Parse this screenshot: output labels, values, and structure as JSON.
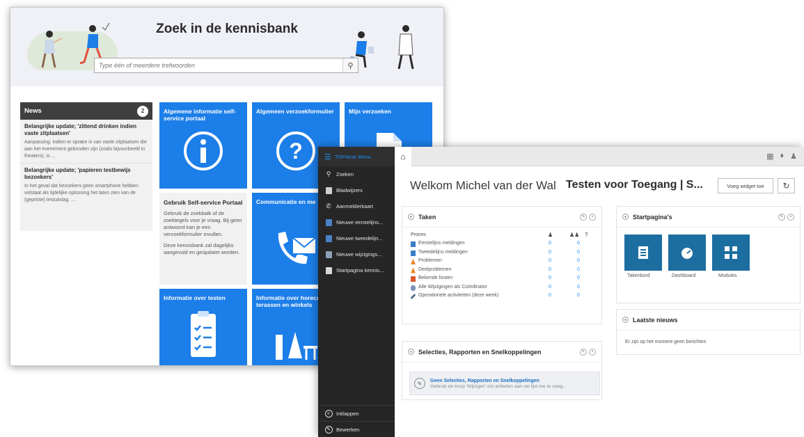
{
  "kb": {
    "title": "Zoek in de kennisbank",
    "search_placeholder": "Type één of meerdere trefwoorden",
    "news": {
      "header": "News",
      "count": "2",
      "items": [
        {
          "title": "Belangrijke update; 'zittend drinken indien vaste zitplaatsen'",
          "body": "Aanpassing: indien er sprake is van vaste zitplaatsen die aan het evenement gebonden zijn (zoals bijvoorbeeld in theaters), is ..."
        },
        {
          "title": "Belangrijke update; 'papieren testbewijs bezoekers'",
          "body": "In het geval dat bezoekers geen smartphone hebben volstaat als tijdelijke oplossing het laten zien van de (geprinte) testuitslag. ..."
        }
      ]
    },
    "tiles": {
      "info_portal": "Algemene informatie self-service portaal",
      "request_form": "Algemeen verzoekformulier",
      "my_requests": "Mijn verzoeken",
      "communication": "Communicatie en me",
      "testing_info": "Informatie over testen",
      "horeca_info": "Informatie over horeca, terassen en winkels"
    },
    "self_service": {
      "title": "Gebruik Self-service Portaal",
      "body1": "Gebruik de zoekbalk of de zoektegels voor je vraag. Bij geen antwoord kan je een verzoekformulier invullen.",
      "body2": "Deze kennisbank zal dagelijks aangevuld en geüpdatet worden."
    }
  },
  "td": {
    "menu_title": "TOPdesk Menu",
    "menu": [
      "Zoeken",
      "Bladwijzers",
      "Aanmelderkaart",
      "Nieuwe eerstelijns...",
      "Nieuwe tweedelijn...",
      "Nieuwe wijzigings...",
      "Startpagina kennis..."
    ],
    "bottom_menu": [
      "Inklappen",
      "Bewerken"
    ],
    "welcome": "Welkom Michel van der Wal",
    "page_title": "Testen voor Toegang | S...",
    "add_widget": "Voeg widget toe",
    "taken": {
      "title": "Taken",
      "col_proces": "Proces",
      "col_3": "?",
      "rows": [
        {
          "label": "Eerstelijns meldingen",
          "v1": "0",
          "v2": "0"
        },
        {
          "label": "Tweedelijns meldingen",
          "v1": "0",
          "v2": "0"
        },
        {
          "label": "Problemen",
          "v1": "0",
          "v2": "0"
        },
        {
          "label": "Deelproblemen",
          "v1": "0",
          "v2": "0"
        },
        {
          "label": "Bekende fouten",
          "v1": "0",
          "v2": "0"
        },
        {
          "label": "Alle Wijzigingen als Coördinator",
          "v1": "0",
          "v2": "0"
        },
        {
          "label": "Operationele activiteiten (deze week)",
          "v1": "0",
          "v2": "0"
        }
      ]
    },
    "startpaginas": {
      "title": "Startpagina's",
      "tiles": [
        "Takenbord",
        "Dashboard",
        "Modules"
      ]
    },
    "laatste_nieuws": {
      "title": "Laatste nieuws",
      "empty": "Er zijn op het moment geen berichten"
    },
    "selecties": {
      "title": "Selecties, Rapporten en Snelkoppelingen",
      "box_title": "Geen Selecties, Rapporten en Snelkoppelingen",
      "box_body": "Gebruik de knop 'Wijzigen' om artikelen aan uw lijst toe te voeg..."
    }
  }
}
